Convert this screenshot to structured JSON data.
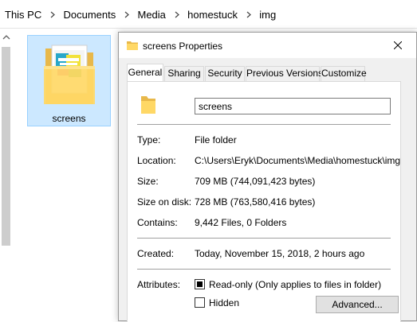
{
  "explorer": {
    "breadcrumb": [
      "This PC",
      "Documents",
      "Media",
      "homestuck",
      "img"
    ],
    "folder": {
      "name": "screens"
    }
  },
  "dialog": {
    "title": "screens Properties",
    "tabs": [
      "General",
      "Sharing",
      "Security",
      "Previous Versions",
      "Customize"
    ],
    "active_tab": "General",
    "folder_name": "screens",
    "fields": {
      "type": {
        "label": "Type:",
        "value": "File folder"
      },
      "location": {
        "label": "Location:",
        "value": "C:\\Users\\Eryk\\Documents\\Media\\homestuck\\img"
      },
      "size": {
        "label": "Size:",
        "value": "709 MB (744,091,423 bytes)"
      },
      "size_on_disk": {
        "label": "Size on disk:",
        "value": "728 MB (763,580,416 bytes)"
      },
      "contains": {
        "label": "Contains:",
        "value": "9,442 Files, 0 Folders"
      },
      "created": {
        "label": "Created:",
        "value": "Today, November 15, 2018, 2 hours ago"
      }
    },
    "attributes": {
      "label": "Attributes:",
      "readonly": {
        "label": "Read-only (Only applies to files in folder)",
        "state": "indeterminate"
      },
      "hidden": {
        "label": "Hidden",
        "checked": false
      },
      "advanced_label": "Advanced..."
    }
  },
  "colors": {
    "selection_fill": "#cce8ff",
    "selection_border": "#99d1ff",
    "folder_yellow": "#ffd866",
    "dialog_bg": "#f0f0f0"
  },
  "icons": [
    "chevron-right-icon",
    "chevron-up-icon",
    "folder-icon",
    "close-icon"
  ]
}
